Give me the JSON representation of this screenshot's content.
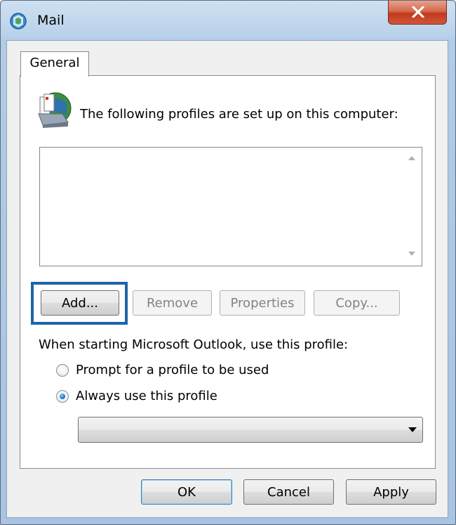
{
  "window": {
    "title": "Mail",
    "close_icon": "close-icon"
  },
  "tabs": [
    {
      "label": "General",
      "selected": true
    }
  ],
  "general": {
    "intro_text": "The following profiles are set up on this computer:",
    "profiles": [],
    "buttons": {
      "add": "Add...",
      "remove": "Remove",
      "properties": "Properties",
      "copy": "Copy..."
    },
    "startup_label": "When starting Microsoft Outlook, use this profile:",
    "options": {
      "prompt": "Prompt for a profile to be used",
      "always": "Always use this profile"
    },
    "selected_option": "always",
    "selected_profile": ""
  },
  "footer": {
    "ok": "OK",
    "cancel": "Cancel",
    "apply": "Apply"
  },
  "colors": {
    "highlight": "#1d64a8",
    "title_bar": "#b9d1ea",
    "close_button": "#c2391c"
  }
}
